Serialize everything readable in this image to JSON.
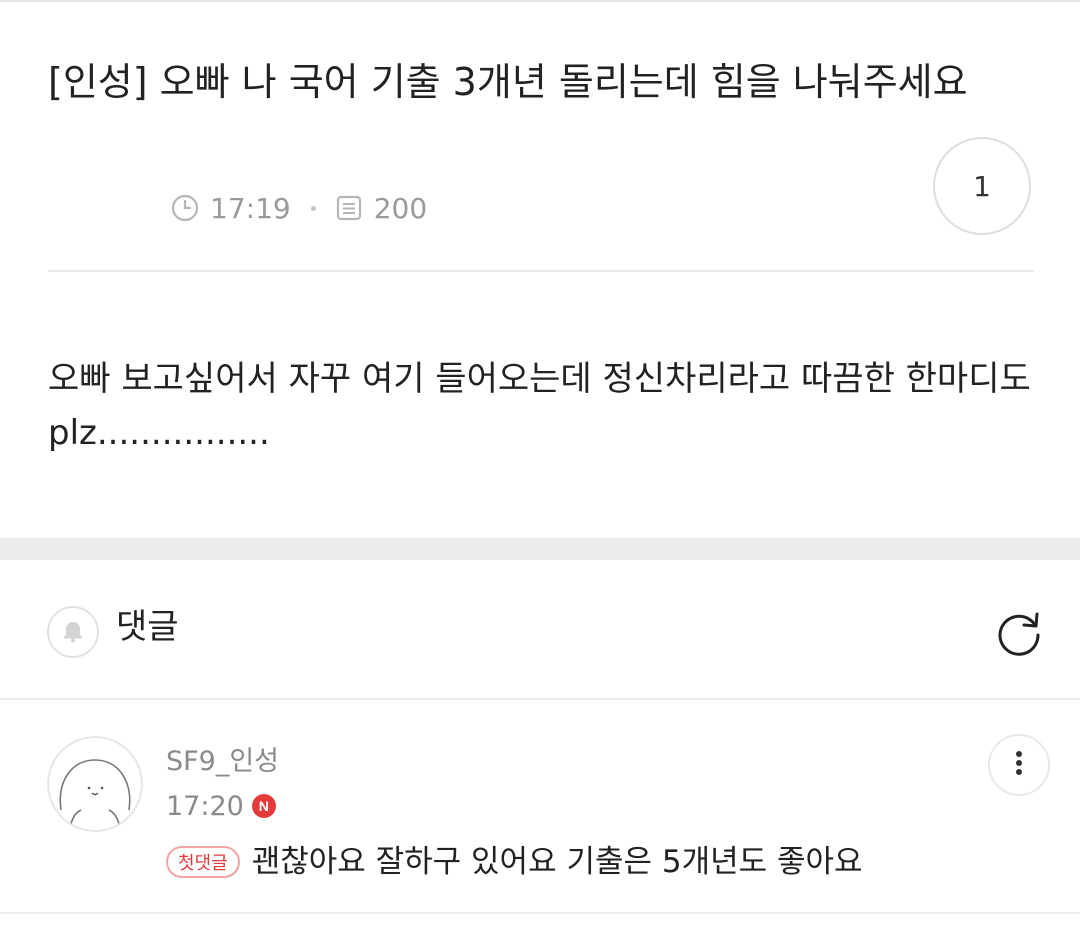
{
  "post": {
    "title": "[인성] 오빠 나 국어 기출 3개년 돌리는데 힘을 나눠주세요",
    "time": "17:19",
    "views": "200",
    "comment_count": "1",
    "body": "오빠 보고싶어서 자꾸 여기 들어오는데 정신차리라고 따끔한 한마디도 plz................"
  },
  "comments_section": {
    "title": "댓글",
    "icons": {
      "bell": "bell-icon",
      "refresh": "refresh-icon"
    }
  },
  "comments": [
    {
      "author": "SF9_인성",
      "time": "17:20",
      "new_badge": "N",
      "first_badge": "첫댓글",
      "text": "괜찮아요 잘하구 있어요 기출은 5개년도 좋아요"
    }
  ],
  "colors": {
    "accent_red": "#e53a3a",
    "muted_text": "#9a9a9a",
    "divider": "#e8e8e8",
    "section_gap": "#ececef"
  }
}
